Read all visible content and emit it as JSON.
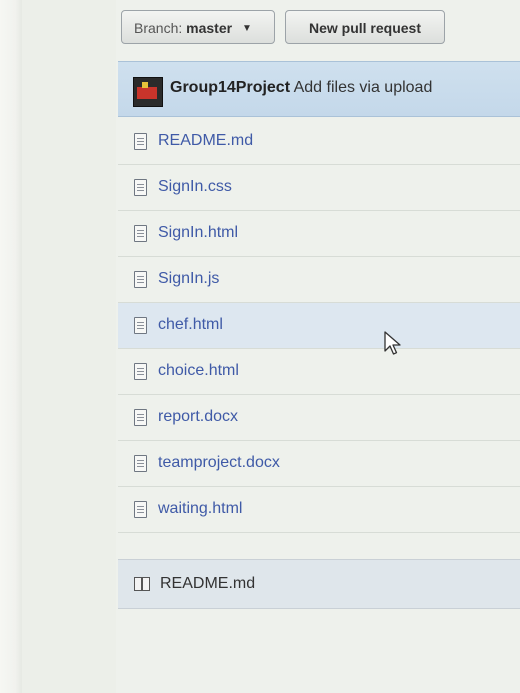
{
  "toolbar": {
    "branch_label": "Branch:",
    "branch_value": "master",
    "new_pr_label": "New pull request"
  },
  "commit": {
    "author": "Group14Project",
    "message": "Add files via upload"
  },
  "files": [
    {
      "name": "README.md"
    },
    {
      "name": "SignIn.css"
    },
    {
      "name": "SignIn.html"
    },
    {
      "name": "SignIn.js"
    },
    {
      "name": "chef.html"
    },
    {
      "name": "choice.html"
    },
    {
      "name": "report.docx"
    },
    {
      "name": "teamproject.docx"
    },
    {
      "name": "waiting.html"
    }
  ],
  "readme": {
    "title": "README.md"
  },
  "colors": {
    "link": "#3f5aa7",
    "commit_bar": "#c4d8ea"
  }
}
